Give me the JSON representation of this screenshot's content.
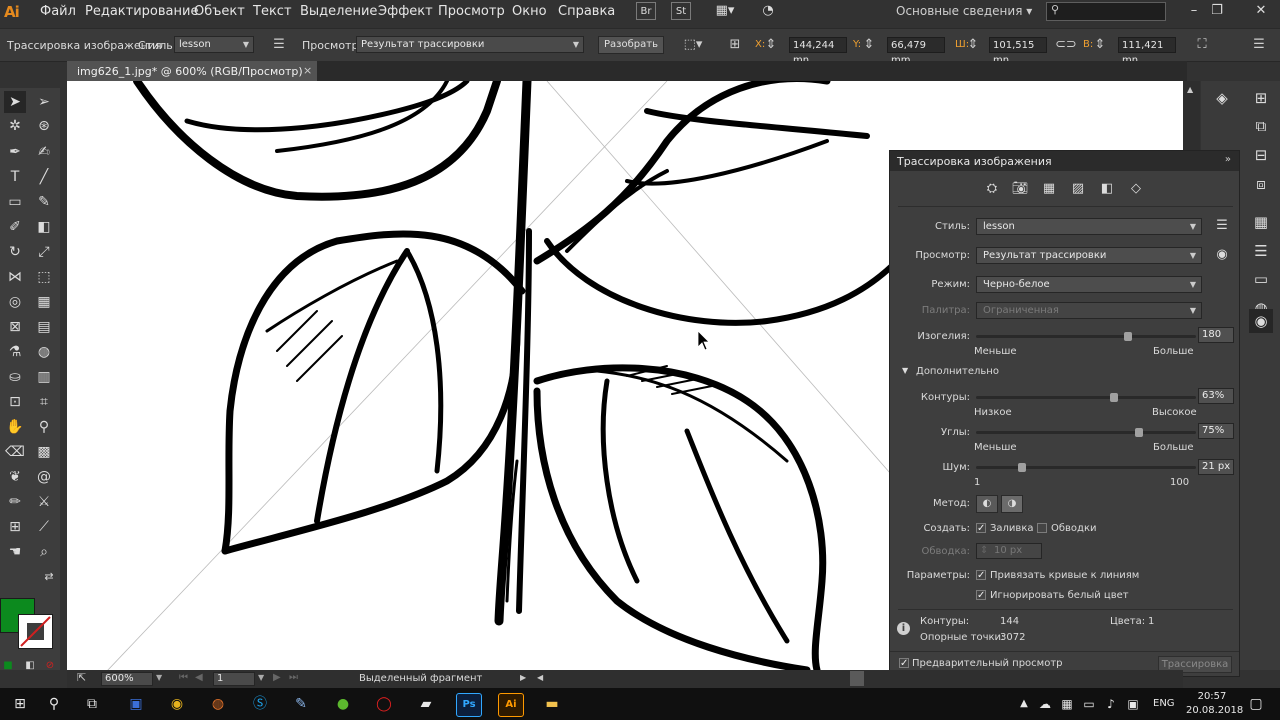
{
  "app": {
    "logo": "Ai",
    "workspace": "Основные сведения"
  },
  "menu": [
    "Файл",
    "Редактирование",
    "Объект",
    "Текст",
    "Выделение",
    "Эффект",
    "Просмотр",
    "Окно",
    "Справка"
  ],
  "menubar_buttons": {
    "br": "Br",
    "st": "St"
  },
  "control": {
    "tool_name": "Трассировка изображения",
    "style_label": "Стиль:",
    "style_value": "lesson",
    "view_label": "Просмотр:",
    "view_value": "Результат трассировки",
    "expand_button": "Разобрать",
    "x_label": "X:",
    "x_value": "144,244 mn",
    "y_label": "Y:",
    "y_value": "66,479 mm",
    "w_label": "Ш:",
    "w_value": "101,515 mn",
    "h_label": "В:",
    "h_value": "111,421 mn"
  },
  "document": {
    "tab_title": "img626_1.jpg* @ 600% (RGB/Просмотр)",
    "close": "×"
  },
  "panel": {
    "title": "Трассировка изображения",
    "style_label": "Стиль:",
    "style_value": "lesson",
    "view_label": "Просмотр:",
    "view_value": "Результат трассировки",
    "mode_label": "Режим:",
    "mode_value": "Черно-белое",
    "palette_label": "Палитра:",
    "palette_value": "Ограниченная",
    "threshold_label": "Изогелия:",
    "threshold_value": "180",
    "threshold_fraction": 0.7,
    "threshold_min": "Меньше",
    "threshold_max": "Больше",
    "advanced_label": "Дополнительно",
    "paths_label": "Контуры:",
    "paths_value": "63%",
    "paths_fraction": 0.63,
    "paths_min": "Низкое",
    "paths_max": "Высокое",
    "corners_label": "Углы:",
    "corners_value": "75%",
    "corners_fraction": 0.75,
    "corners_min": "Меньше",
    "corners_max": "Больше",
    "noise_label": "Шум:",
    "noise_value": "21 px",
    "noise_fraction": 0.2,
    "noise_min": "1",
    "noise_max": "100",
    "method_label": "Метод:",
    "create_label": "Создать:",
    "fill_label": "Заливка",
    "fill_checked": true,
    "strokes_label": "Обводки",
    "strokes_checked": false,
    "stroke_label": "Обводка:",
    "stroke_value": "10 px",
    "options_label": "Параметры:",
    "snap_label": "Привязать кривые к линиям",
    "snap_checked": true,
    "ignore_white_label": "Игнорировать белый цвет",
    "ignore_white_checked": true,
    "info_paths_label": "Контуры:",
    "info_paths_value": "144",
    "info_colors_label": "Цвета:",
    "info_colors_value": "1",
    "info_anchors_label": "Опорные точки:",
    "info_anchors_value": "3072",
    "preview_label": "Предварительный просмотр",
    "preview_checked": true,
    "trace_button": "Трассировка"
  },
  "status": {
    "zoom": "600%",
    "artboard": "1",
    "text": "Выделенный фрагмент"
  },
  "taskbar": {
    "lang": "ENG",
    "time": "20:57",
    "date": "20.08.2018",
    "ps": "Ps",
    "ai": "Ai"
  },
  "colors": {
    "fill": "#0c8a1e",
    "accent_ai": "#e58a1e",
    "canvas": "#ffffff"
  }
}
